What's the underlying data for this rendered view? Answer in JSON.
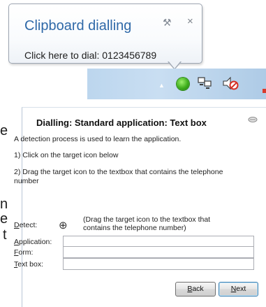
{
  "edge_text": [
    "e",
    "n",
    "e",
    "t"
  ],
  "balloon": {
    "title": "Clipboard dialling",
    "message": "Click here to dial: 0123456789",
    "wrench_glyph": "⚒",
    "close_glyph": "×"
  },
  "tray": {
    "arrow_glyph": "▲",
    "icons": [
      "dialling-app-icon",
      "network-icon",
      "volume-muted-icon"
    ],
    "dial_color": "#3fae1d"
  },
  "dialog": {
    "title": "Dialling: Standard application: Text box",
    "intro": "A detection process is used to learn the application.",
    "step1": "1) Click on the target icon below",
    "step2": "2) Drag the target icon to the textbox that contains the telephone number",
    "detect_label_first": "D",
    "detect_label_rest": "etect:",
    "target_glyph": "⊕",
    "detect_hint": "(Drag the target icon to the textbox that contains the telephone number)",
    "fields": {
      "application": {
        "label_first": "A",
        "label_rest": "pplication:",
        "value": ""
      },
      "form": {
        "label_first": "F",
        "label_rest": "orm:",
        "value": ""
      },
      "textbox": {
        "label_first": "T",
        "label_rest": "ext box:",
        "value": ""
      }
    },
    "back_first": "B",
    "back_rest": "ack",
    "next_first": "N",
    "next_rest": "ext"
  }
}
